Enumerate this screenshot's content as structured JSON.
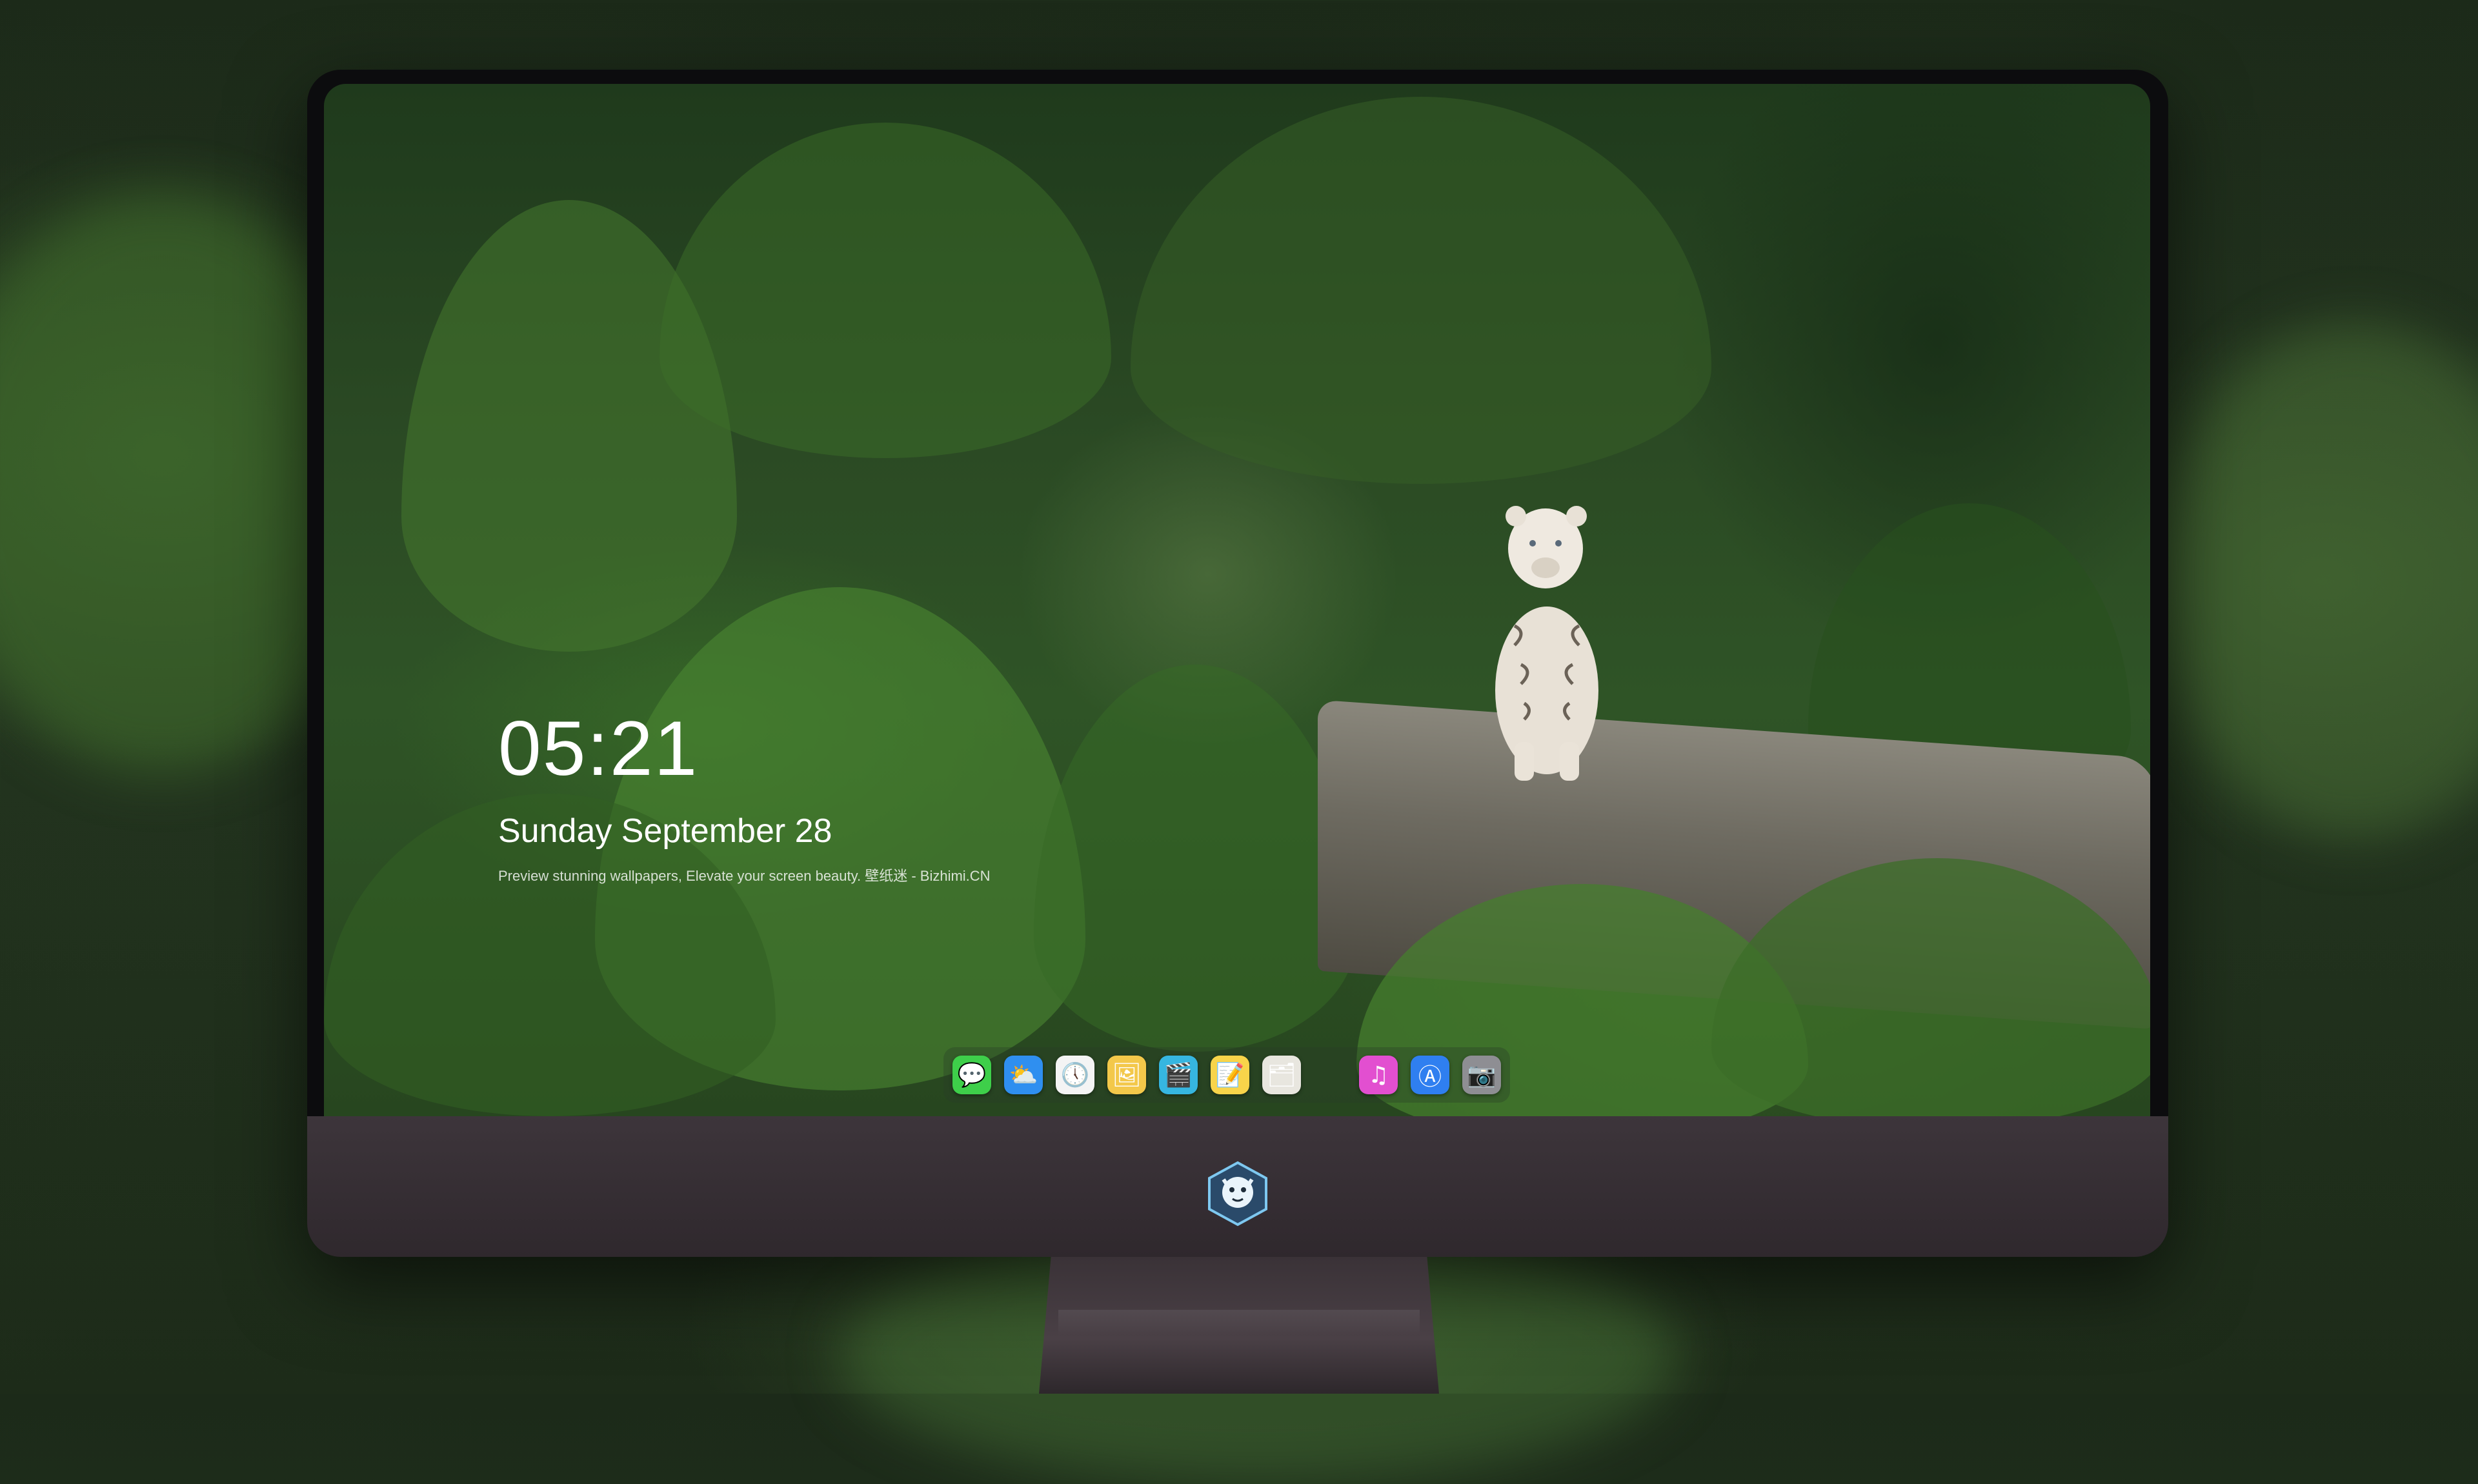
{
  "lockscreen": {
    "time": "05:21",
    "date": "Sunday September  28",
    "tagline": "Preview stunning wallpapers, Elevate your screen beauty. 壁纸迷 - Bizhimi.CN"
  },
  "dock": {
    "apps": [
      {
        "name": "messages",
        "icon": "messages-icon",
        "glyph": "💬",
        "color": "#3ecf4a"
      },
      {
        "name": "weather",
        "icon": "weather-icon",
        "glyph": "⛅",
        "color": "#2f8ff0"
      },
      {
        "name": "clock",
        "icon": "clock-icon",
        "glyph": "🕔",
        "color": "#f4f4f4"
      },
      {
        "name": "preview",
        "icon": "preview-icon",
        "glyph": "🖼",
        "color": "#f3c84a"
      },
      {
        "name": "clips",
        "icon": "clapperboard-icon",
        "glyph": "🎬",
        "color": "#36b6e0"
      },
      {
        "name": "notes",
        "icon": "notes-icon",
        "glyph": "📝",
        "color": "#f8d44a"
      },
      {
        "name": "photos-gallery",
        "icon": "gallery-icon",
        "glyph": "🗂",
        "color": "#e8e6df"
      },
      {
        "name": "music",
        "icon": "music-icon",
        "glyph": "♫",
        "color": "#e24fd0"
      },
      {
        "name": "app-store",
        "icon": "app-store-icon",
        "glyph": "Ⓐ",
        "color": "#2f7ff0"
      },
      {
        "name": "camera",
        "icon": "camera-icon",
        "glyph": "📷",
        "color": "#8e8e93"
      }
    ]
  }
}
